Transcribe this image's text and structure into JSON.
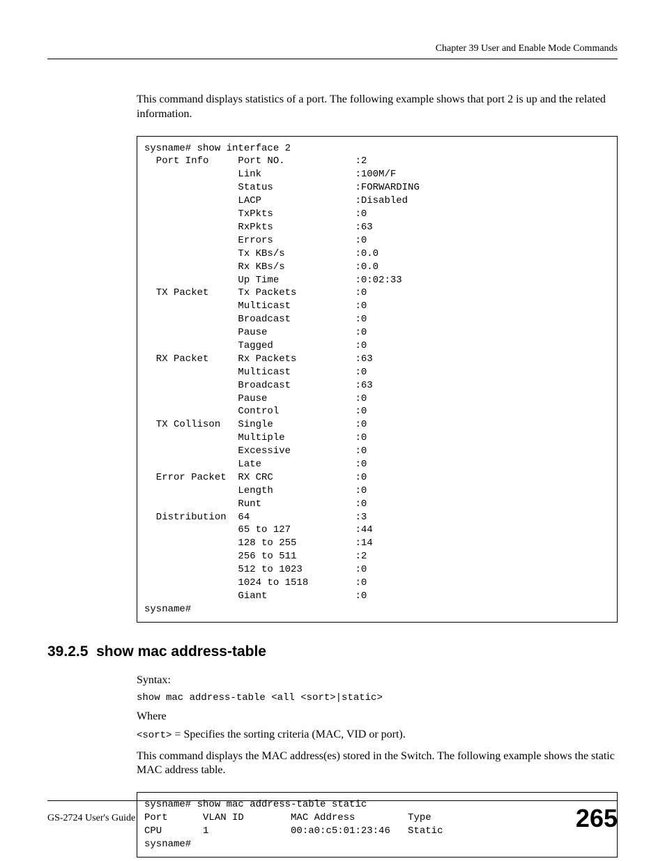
{
  "header": {
    "chapter": "Chapter 39 User and Enable Mode Commands"
  },
  "intro_para": "This command displays statistics of a port. The following example shows that port 2 is up and the related information.",
  "code1": "sysname# show interface 2\n  Port Info     Port NO.            :2\n                Link                :100M/F\n                Status              :FORWARDING\n                LACP                :Disabled\n                TxPkts              :0\n                RxPkts              :63\n                Errors              :0\n                Tx KBs/s            :0.0\n                Rx KBs/s            :0.0\n                Up Time             :0:02:33\n  TX Packet     Tx Packets          :0\n                Multicast           :0\n                Broadcast           :0\n                Pause               :0\n                Tagged              :0\n  RX Packet     Rx Packets          :63\n                Multicast           :0\n                Broadcast           :63\n                Pause               :0\n                Control             :0\n  TX Collison   Single              :0\n                Multiple            :0\n                Excessive           :0\n                Late                :0\n  Error Packet  RX CRC              :0\n                Length              :0\n                Runt                :0\n  Distribution  64                  :3\n                65 to 127           :44\n                128 to 255          :14\n                256 to 511          :2\n                512 to 1023         :0\n                1024 to 1518        :0\n                Giant               :0\nsysname#",
  "section": {
    "number": "39.2.5",
    "title": "show mac address-table"
  },
  "syntax_label": "Syntax:",
  "syntax_line": "show mac address-table <all <sort>|static>",
  "where_label": "Where",
  "sort_param": "<sort>",
  "sort_desc": " = Specifies the sorting criteria (MAC, VID or port).",
  "desc_para": "This command displays the MAC address(es) stored in the Switch. The following example shows the static MAC address table.",
  "code2": "sysname# show mac address-table static\nPort      VLAN ID        MAC Address         Type\nCPU       1              00:a0:c5:01:23:46   Static\nsysname#",
  "footer": {
    "guide": "GS-2724 User's Guide",
    "page": "265"
  }
}
